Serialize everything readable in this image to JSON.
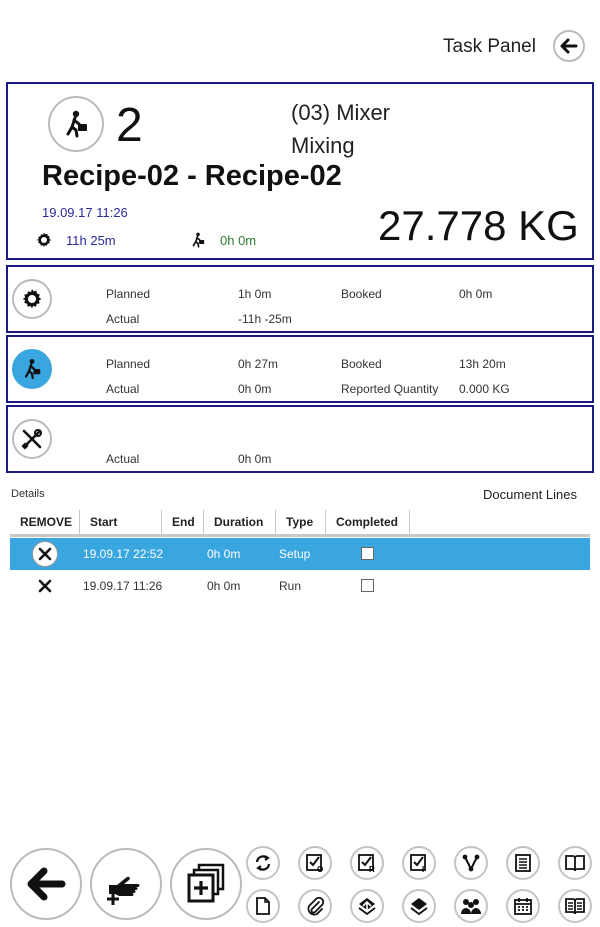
{
  "header": {
    "title": "Task Panel",
    "back_icon": "arrow-left-icon"
  },
  "operation": {
    "count": "2",
    "machine": "(03) Mixer",
    "step": "Mixing",
    "recipe": "Recipe-02 - Recipe-02",
    "date": "19.09.17 11:26",
    "setup_time": "11h  25m",
    "run_time": "0h 0m",
    "quantity": "27.778 KG"
  },
  "setup_row": {
    "planned_label": "Planned",
    "planned": "1h 0m",
    "booked_label": "Booked",
    "booked": "0h 0m",
    "actual_label": "Actual",
    "actual": "-11h -25m"
  },
  "run_row": {
    "planned_label": "Planned",
    "planned": "0h 27m",
    "booked_label": "Booked",
    "booked": "13h 20m",
    "actual_label": "Actual",
    "actual": "0h 0m",
    "reported_label": "Reported Quantity",
    "reported": "0.000 KG"
  },
  "maint_row": {
    "actual_label": "Actual",
    "actual": "0h 0m"
  },
  "details": {
    "label": "Details",
    "doc_lines": "Document Lines",
    "columns": [
      "REMOVE",
      "Start",
      "End",
      "Duration",
      "Type",
      "Completed"
    ],
    "rows": [
      {
        "start": "19.09.17 22:52",
        "end": "",
        "duration": "0h 0m",
        "type": "Setup",
        "completed": false,
        "selected": true
      },
      {
        "start": "19.09.17 11:26",
        "end": "",
        "duration": "0h 0m",
        "type": "Run",
        "completed": false,
        "selected": false
      }
    ]
  },
  "colors": {
    "accent": "#3aa6e0",
    "border": "#1a1a80",
    "date": "#2a2a9a",
    "run_time": "#2e7d32"
  }
}
